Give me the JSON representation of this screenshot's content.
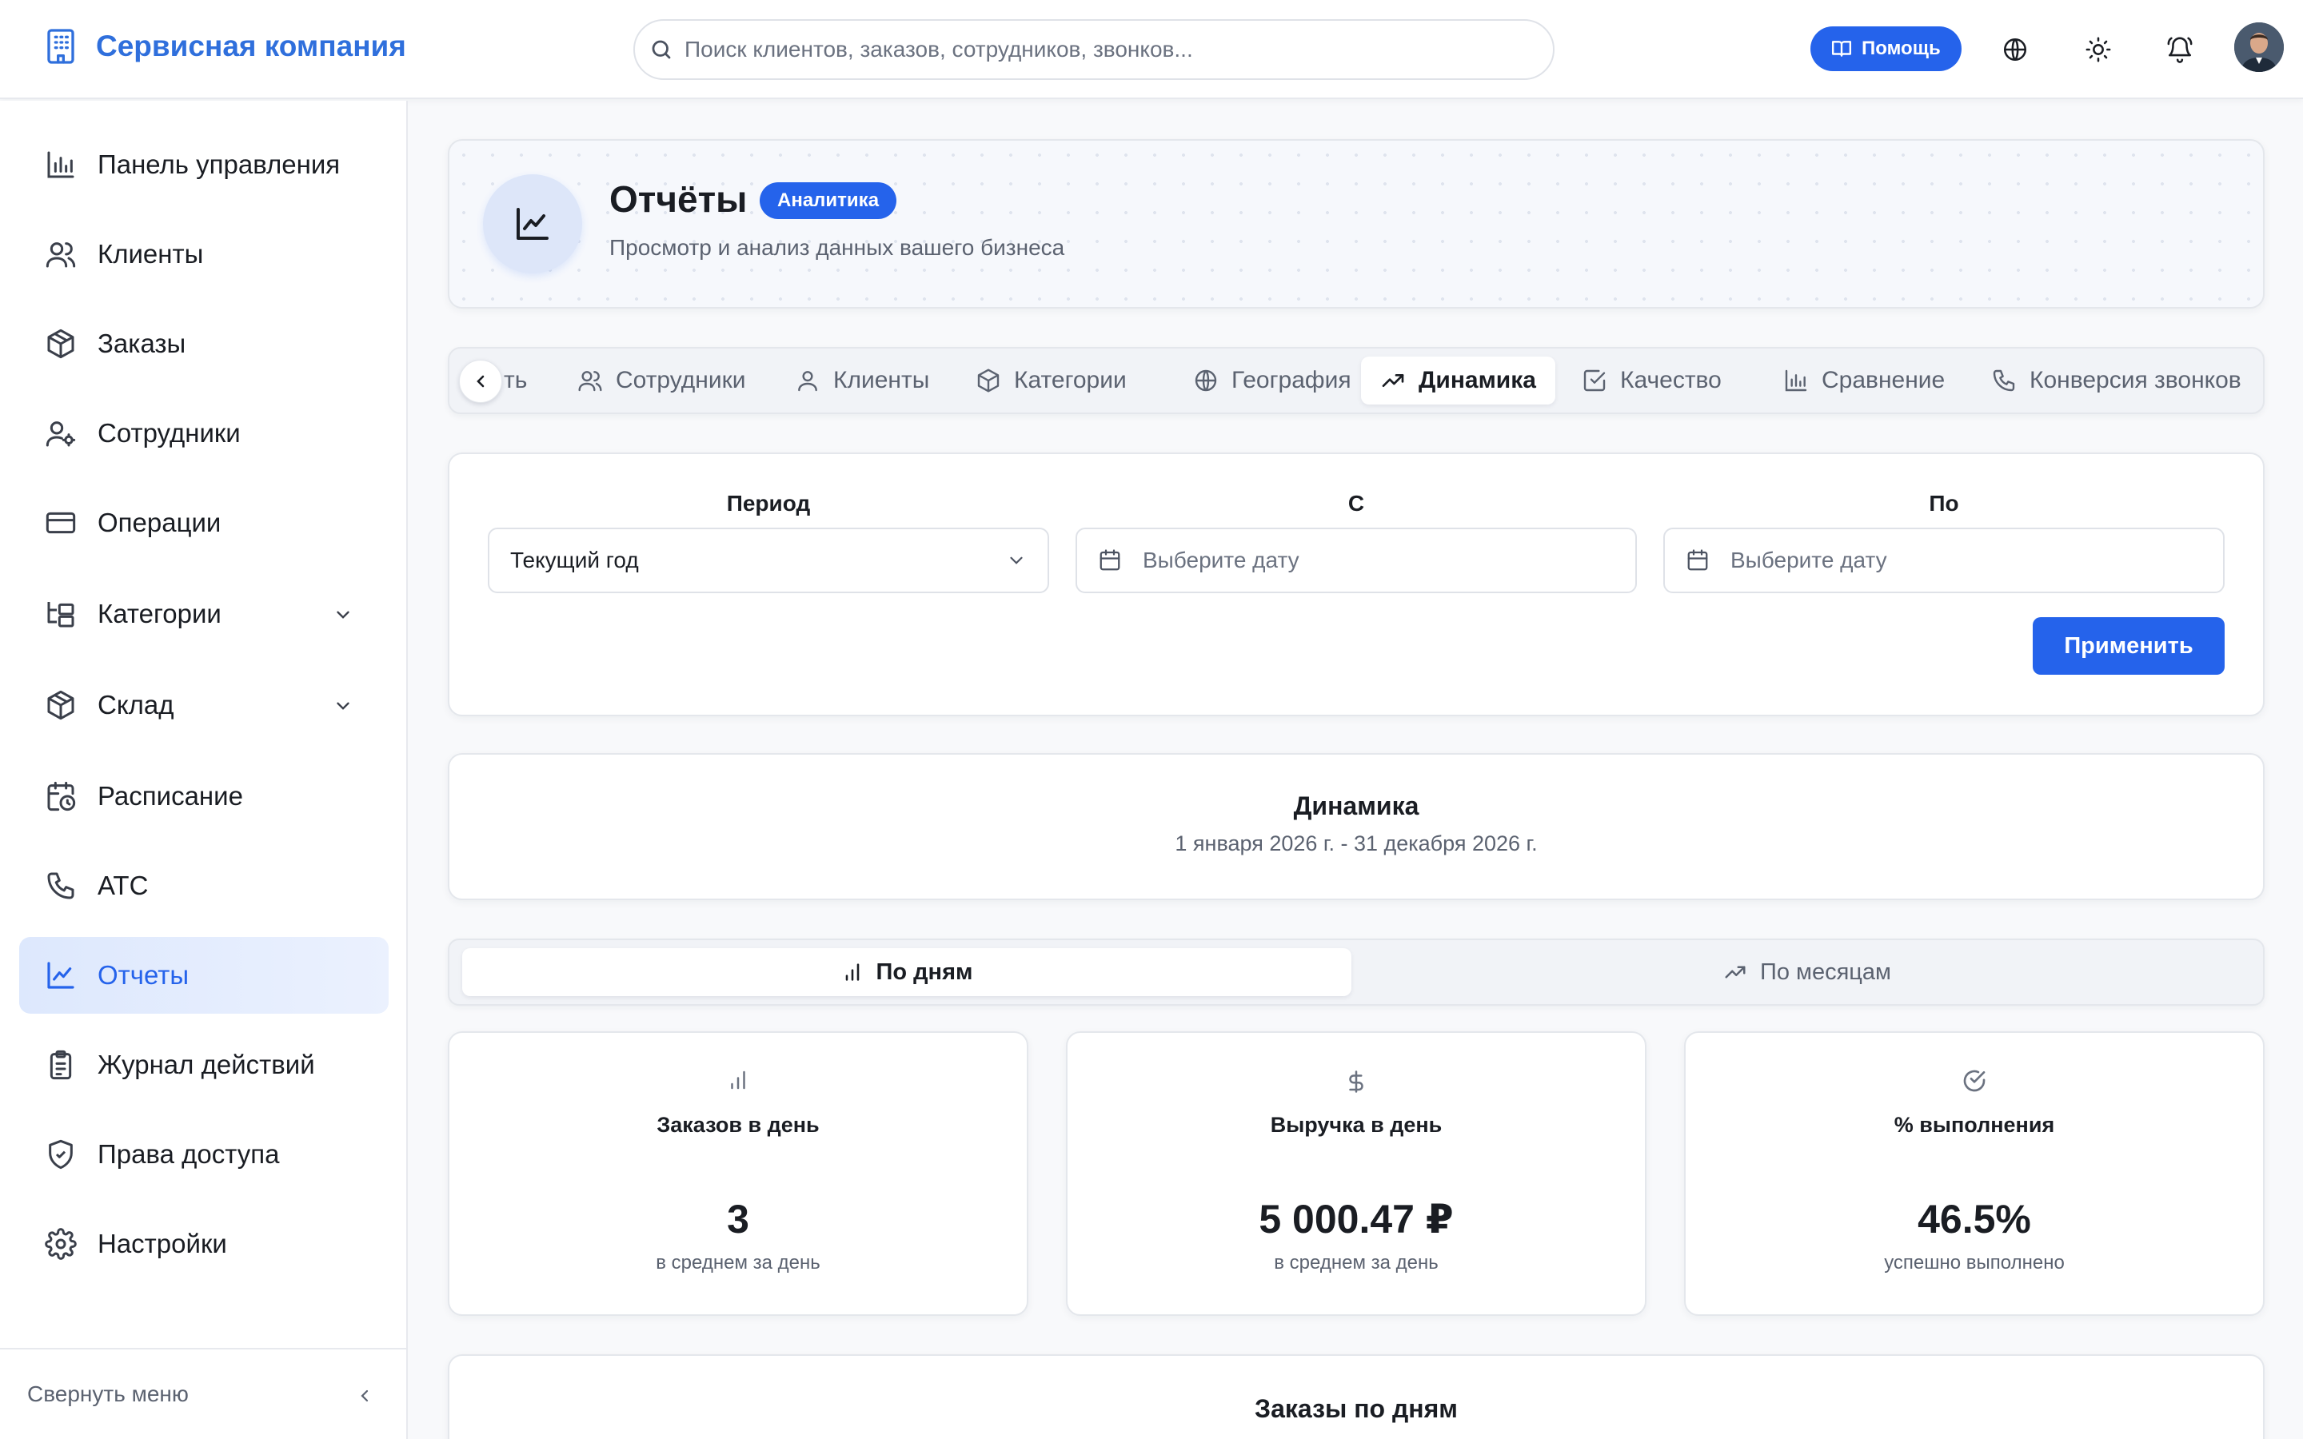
{
  "app": {
    "brand_name": "Сервисная компания"
  },
  "header": {
    "search_placeholder": "Поиск клиентов, заказов, сотрудников, звонков...",
    "help_label": "Помощь",
    "icons": [
      "globe-icon",
      "sun-icon",
      "bell-icon"
    ]
  },
  "sidebar": {
    "items": [
      {
        "label": "Панель управления",
        "icon": "bar-chart-icon"
      },
      {
        "label": "Клиенты",
        "icon": "users-icon"
      },
      {
        "label": "Заказы",
        "icon": "box-icon"
      },
      {
        "label": "Сотрудники",
        "icon": "user-cog-icon"
      },
      {
        "label": "Операции",
        "icon": "credit-card-icon"
      },
      {
        "label": "Категории",
        "icon": "folder-tree-icon",
        "expandable": true
      },
      {
        "label": "Склад",
        "icon": "box-icon",
        "expandable": true
      },
      {
        "label": "Расписание",
        "icon": "calendar-clock-icon"
      },
      {
        "label": "АТС",
        "icon": "phone-icon"
      },
      {
        "label": "Отчеты",
        "icon": "line-chart-icon",
        "active": true
      },
      {
        "label": "Журнал действий",
        "icon": "clipboard-icon"
      },
      {
        "label": "Права доступа",
        "icon": "shield-icon"
      },
      {
        "label": "Настройки",
        "icon": "gear-icon"
      }
    ],
    "collapse_label": "Свернуть меню"
  },
  "page": {
    "title": "Отчёты",
    "badge": "Аналитика",
    "subtitle": "Просмотр и анализ данных вашего бизнеса"
  },
  "tabs": {
    "items": [
      {
        "label": "ть",
        "icon": ""
      },
      {
        "label": "Сотрудники",
        "icon": "users-icon"
      },
      {
        "label": "Клиенты",
        "icon": "user-icon"
      },
      {
        "label": "Категории",
        "icon": "box-icon"
      },
      {
        "label": "География",
        "icon": "globe-icon"
      },
      {
        "label": "Динамика",
        "icon": "trending-up-icon",
        "active": true
      },
      {
        "label": "Качество",
        "icon": "check-square-icon"
      },
      {
        "label": "Сравнение",
        "icon": "bar-chart-icon"
      },
      {
        "label": "Конверсия звонков",
        "icon": "phone-icon"
      }
    ]
  },
  "filters": {
    "period_label": "Период",
    "period_value": "Текущий год",
    "from_label": "С",
    "from_placeholder": "Выберите дату",
    "to_label": "По",
    "to_placeholder": "Выберите дату",
    "apply_label": "Применить"
  },
  "dynamics": {
    "title": "Динамика",
    "range": "1 января 2026 г. - 31 декабря 2026 г."
  },
  "segment": {
    "by_days": "По дням",
    "by_months": "По месяцам",
    "active": "by_days"
  },
  "stats": [
    {
      "icon": "bar-chart-icon",
      "label": "Заказов в день",
      "value": "3",
      "sub": "в среднем за день"
    },
    {
      "icon": "dollar-icon",
      "label": "Выручка в день",
      "value": "5 000.47 ₽",
      "sub": "в среднем за день"
    },
    {
      "icon": "check-circle-icon",
      "label": "% выполнения",
      "value": "46.5%",
      "sub": "успешно выполнено"
    }
  ],
  "orders_by_day": {
    "title": "Заказы по дням"
  },
  "colors": {
    "accent": "#2563eb",
    "brand": "#2f6fdc",
    "muted": "#5b6270"
  }
}
